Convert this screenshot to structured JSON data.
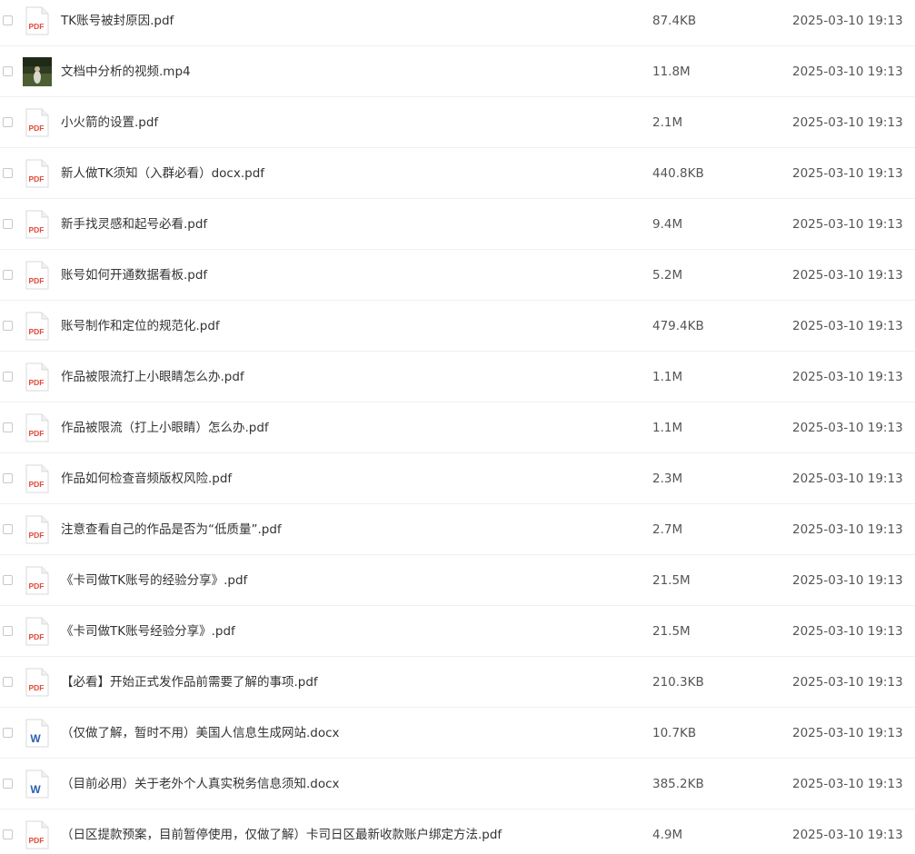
{
  "files": [
    {
      "name": "TK账号被封原因.pdf",
      "size": "87.4KB",
      "modified": "2025-03-10 19:13",
      "type_icon": "pdf-icon"
    },
    {
      "name": "文档中分析的视频.mp4",
      "size": "11.8M",
      "modified": "2025-03-10 19:13",
      "type_icon": "video-thumbnail"
    },
    {
      "name": "小火箭的设置.pdf",
      "size": "2.1M",
      "modified": "2025-03-10 19:13",
      "type_icon": "pdf-icon"
    },
    {
      "name": "新人做TK须知（入群必看）docx.pdf",
      "size": "440.8KB",
      "modified": "2025-03-10 19:13",
      "type_icon": "pdf-icon"
    },
    {
      "name": "新手找灵感和起号必看.pdf",
      "size": "9.4M",
      "modified": "2025-03-10 19:13",
      "type_icon": "pdf-icon"
    },
    {
      "name": "账号如何开通数据看板.pdf",
      "size": "5.2M",
      "modified": "2025-03-10 19:13",
      "type_icon": "pdf-icon"
    },
    {
      "name": "账号制作和定位的规范化.pdf",
      "size": "479.4KB",
      "modified": "2025-03-10 19:13",
      "type_icon": "pdf-icon"
    },
    {
      "name": "作品被限流打上小眼睛怎么办.pdf",
      "size": "1.1M",
      "modified": "2025-03-10 19:13",
      "type_icon": "pdf-icon"
    },
    {
      "name": "作品被限流（打上小眼睛）怎么办.pdf",
      "size": "1.1M",
      "modified": "2025-03-10 19:13",
      "type_icon": "pdf-icon"
    },
    {
      "name": "作品如何检查音频版权风险.pdf",
      "size": "2.3M",
      "modified": "2025-03-10 19:13",
      "type_icon": "pdf-icon"
    },
    {
      "name": "注意查看自己的作品是否为“低质量”.pdf",
      "size": "2.7M",
      "modified": "2025-03-10 19:13",
      "type_icon": "pdf-icon"
    },
    {
      "name": "《卡司做TK账号的经验分享》.pdf",
      "size": "21.5M",
      "modified": "2025-03-10 19:13",
      "type_icon": "pdf-icon"
    },
    {
      "name": "《卡司做TK账号经验分享》.pdf",
      "size": "21.5M",
      "modified": "2025-03-10 19:13",
      "type_icon": "pdf-icon"
    },
    {
      "name": "【必看】开始正式发作品前需要了解的事项.pdf",
      "size": "210.3KB",
      "modified": "2025-03-10 19:13",
      "type_icon": "pdf-icon"
    },
    {
      "name": "（仅做了解，暂时不用）美国人信息生成网站.docx",
      "size": "10.7KB",
      "modified": "2025-03-10 19:13",
      "type_icon": "word-icon"
    },
    {
      "name": "（目前必用）关于老外个人真实税务信息须知.docx",
      "size": "385.2KB",
      "modified": "2025-03-10 19:13",
      "type_icon": "word-icon"
    },
    {
      "name": "（日区提款预案，目前暂停使用，仅做了解）卡司日区最新收款账户绑定方法.pdf",
      "size": "4.9M",
      "modified": "2025-03-10 19:13",
      "type_icon": "pdf-icon"
    }
  ],
  "icon_labels": {
    "pdf": "PDF",
    "word": "W"
  },
  "colors": {
    "pdf_red": "#e04b3c",
    "word_blue": "#2b5fb4",
    "divider": "#eef0f2"
  }
}
